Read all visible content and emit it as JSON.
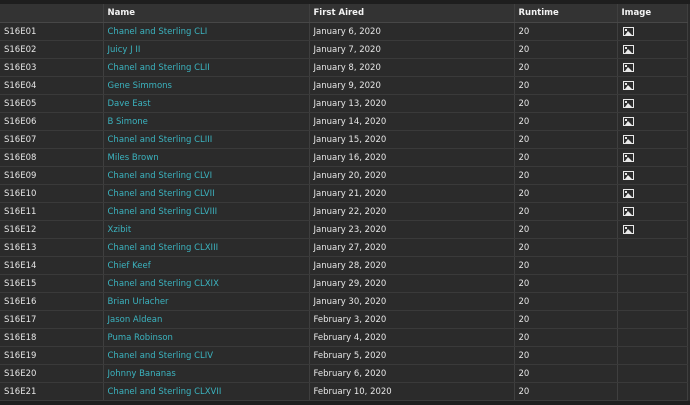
{
  "columns": {
    "episode": "",
    "name": "Name",
    "first_aired": "First Aired",
    "runtime": "Runtime",
    "image": "Image"
  },
  "icons": {
    "image": "image-icon"
  },
  "colors": {
    "link": "#3bb3bf"
  },
  "episodes": [
    {
      "code": "S16E01",
      "name": "Chanel and Sterling CLI",
      "aired": "January 6, 2020",
      "runtime": "20",
      "has_image": true
    },
    {
      "code": "S16E02",
      "name": "Juicy J II",
      "aired": "January 7, 2020",
      "runtime": "20",
      "has_image": true
    },
    {
      "code": "S16E03",
      "name": "Chanel and Sterling CLII",
      "aired": "January 8, 2020",
      "runtime": "20",
      "has_image": true
    },
    {
      "code": "S16E04",
      "name": "Gene Simmons",
      "aired": "January 9, 2020",
      "runtime": "20",
      "has_image": true
    },
    {
      "code": "S16E05",
      "name": "Dave East",
      "aired": "January 13, 2020",
      "runtime": "20",
      "has_image": true
    },
    {
      "code": "S16E06",
      "name": "B Simone",
      "aired": "January 14, 2020",
      "runtime": "20",
      "has_image": true
    },
    {
      "code": "S16E07",
      "name": "Chanel and Sterling CLIII",
      "aired": "January 15, 2020",
      "runtime": "20",
      "has_image": true
    },
    {
      "code": "S16E08",
      "name": "Miles Brown",
      "aired": "January 16, 2020",
      "runtime": "20",
      "has_image": true
    },
    {
      "code": "S16E09",
      "name": "Chanel and Sterling CLVI",
      "aired": "January 20, 2020",
      "runtime": "20",
      "has_image": true
    },
    {
      "code": "S16E10",
      "name": "Chanel and Sterling CLVII",
      "aired": "January 21, 2020",
      "runtime": "20",
      "has_image": true
    },
    {
      "code": "S16E11",
      "name": "Chanel and Sterling CLVIII",
      "aired": "January 22, 2020",
      "runtime": "20",
      "has_image": true
    },
    {
      "code": "S16E12",
      "name": "Xzibit",
      "aired": "January 23, 2020",
      "runtime": "20",
      "has_image": true
    },
    {
      "code": "S16E13",
      "name": "Chanel and Sterling CLXIII",
      "aired": "January 27, 2020",
      "runtime": "20",
      "has_image": false
    },
    {
      "code": "S16E14",
      "name": "Chief Keef",
      "aired": "January 28, 2020",
      "runtime": "20",
      "has_image": false
    },
    {
      "code": "S16E15",
      "name": "Chanel and Sterling CLXIX",
      "aired": "January 29, 2020",
      "runtime": "20",
      "has_image": false
    },
    {
      "code": "S16E16",
      "name": "Brian Urlacher",
      "aired": "January 30, 2020",
      "runtime": "20",
      "has_image": false
    },
    {
      "code": "S16E17",
      "name": "Jason Aldean",
      "aired": "February 3, 2020",
      "runtime": "20",
      "has_image": false
    },
    {
      "code": "S16E18",
      "name": "Puma Robinson",
      "aired": "February 4, 2020",
      "runtime": "20",
      "has_image": false
    },
    {
      "code": "S16E19",
      "name": "Chanel and Sterling CLIV",
      "aired": "February 5, 2020",
      "runtime": "20",
      "has_image": false
    },
    {
      "code": "S16E20",
      "name": "Johnny Bananas",
      "aired": "February 6, 2020",
      "runtime": "20",
      "has_image": false
    },
    {
      "code": "S16E21",
      "name": "Chanel and Sterling CLXVII",
      "aired": "February 10, 2020",
      "runtime": "20",
      "has_image": false
    }
  ]
}
